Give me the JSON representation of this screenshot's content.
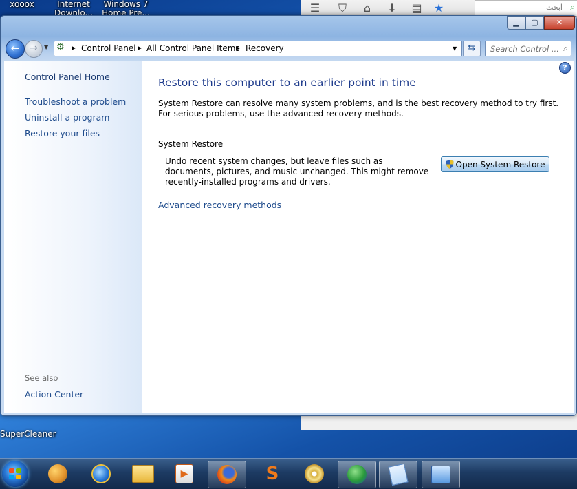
{
  "desktop": {
    "top_icons": [
      {
        "label1": "xooox",
        "label2": ""
      },
      {
        "label1": "Internet",
        "label2": "Downlo..."
      },
      {
        "label1": "Windows 7",
        "label2": "Home Pre..."
      }
    ],
    "bottom_icon": "SuperCleaner"
  },
  "browser": {
    "search_placeholder": "ابحث"
  },
  "window": {
    "address": {
      "crumbs": [
        "Control Panel",
        "All Control Panel Items",
        "Recovery"
      ]
    },
    "search_placeholder": "Search Control ...",
    "left_pane": {
      "home": "Control Panel Home",
      "links": [
        "Troubleshoot a problem",
        "Uninstall a program",
        "Restore your files"
      ],
      "see_also": "See also",
      "see_also_links": [
        "Action Center"
      ]
    },
    "main": {
      "title": "Restore this computer to an earlier point in time",
      "description": "System Restore can resolve many system problems, and is the best recovery method to try first. For serious problems, use the advanced recovery methods.",
      "section_title": "System Restore",
      "section_description": "Undo recent system changes, but leave files such as documents, pictures, and music unchanged. This might remove recently-installed programs and drivers.",
      "restore_button": "Open System Restore",
      "advanced_link": "Advanced recovery methods"
    }
  },
  "colors": {
    "link": "#1e4b8c",
    "title": "#1e3b8c"
  }
}
